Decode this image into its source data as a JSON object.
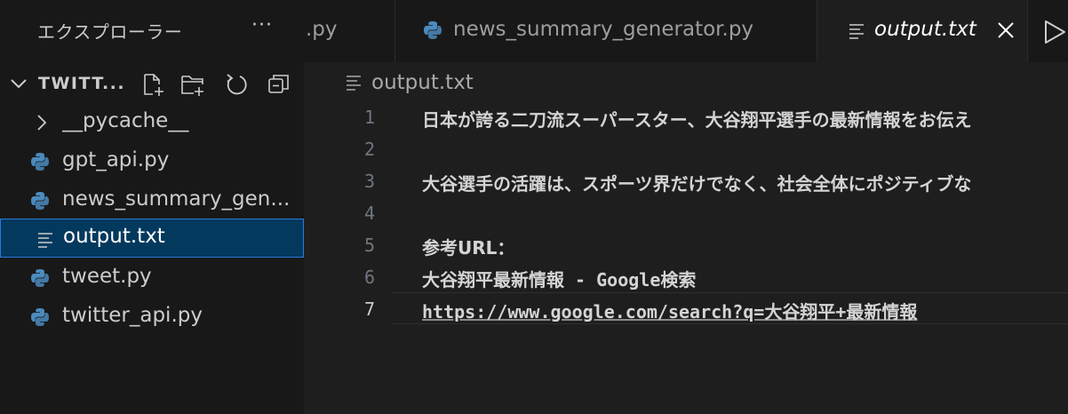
{
  "explorer": {
    "title": "エクスプローラー",
    "more": "···",
    "folder_name": "TWITT..."
  },
  "tree": [
    {
      "label": "__pycache__",
      "kind": "folder"
    },
    {
      "label": "gpt_api.py",
      "kind": "python"
    },
    {
      "label": "news_summary_gen...",
      "kind": "python"
    },
    {
      "label": "output.txt",
      "kind": "text",
      "selected": true
    },
    {
      "label": "tweet.py",
      "kind": "python"
    },
    {
      "label": "twitter_api.py",
      "kind": "python"
    }
  ],
  "tabs": [
    {
      "label": ".py"
    },
    {
      "label": "news_summary_generator.py"
    },
    {
      "label": "output.txt",
      "active": true
    }
  ],
  "breadcrumb": "output.txt",
  "editor": {
    "line_numbers": [
      "1",
      "2",
      "3",
      "4",
      "5",
      "6",
      "7"
    ],
    "lines": [
      "日本が誇る二刀流スーパースター、大谷翔平選手の最新情報をお伝え",
      "",
      "大谷選手の活躍は、スポーツ界だけでなく、社会全体にポジティブな",
      "",
      "参考URL：",
      "大谷翔平最新情報 - Google検索",
      "https://www.google.com/search?q=大谷翔平+最新情報"
    ],
    "active_line": 7
  },
  "colors": {
    "selection_bg": "#04395e",
    "selection_border": "#2b79d8",
    "python_blue": "#4b8bbe",
    "python_yellow": "#ffd43b"
  }
}
